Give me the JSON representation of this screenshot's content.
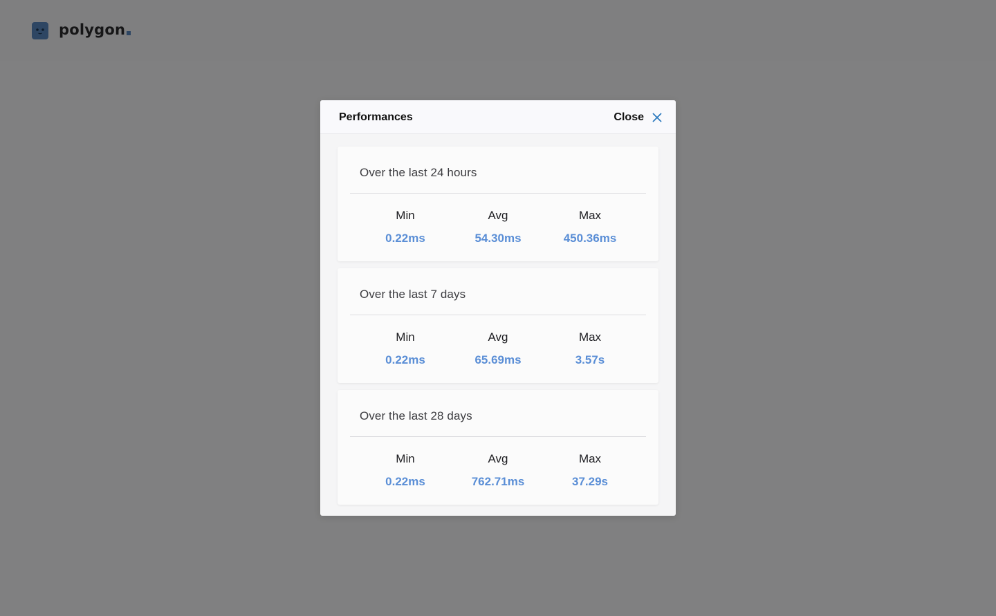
{
  "app": {
    "logo_text": "polygon"
  },
  "modal": {
    "title": "Performances",
    "close_label": "Close",
    "sections": [
      {
        "title": "Over the last 24 hours",
        "stats": [
          {
            "label": "Min",
            "value": "0.22ms"
          },
          {
            "label": "Avg",
            "value": "54.30ms"
          },
          {
            "label": "Max",
            "value": "450.36ms"
          }
        ]
      },
      {
        "title": "Over the last 7 days",
        "stats": [
          {
            "label": "Min",
            "value": "0.22ms"
          },
          {
            "label": "Avg",
            "value": "65.69ms"
          },
          {
            "label": "Max",
            "value": "3.57s"
          }
        ]
      },
      {
        "title": "Over the last 28 days",
        "stats": [
          {
            "label": "Min",
            "value": "0.22ms"
          },
          {
            "label": "Avg",
            "value": "762.71ms"
          },
          {
            "label": "Max",
            "value": "37.29s"
          }
        ]
      }
    ]
  },
  "colors": {
    "overlay": "#808081",
    "accent_value": "#5a8ed6",
    "close_icon": "#2e7bbf",
    "logo": "#2e4663"
  },
  "icons": {
    "close": "close-icon",
    "logo": "polygon-logo-icon"
  }
}
